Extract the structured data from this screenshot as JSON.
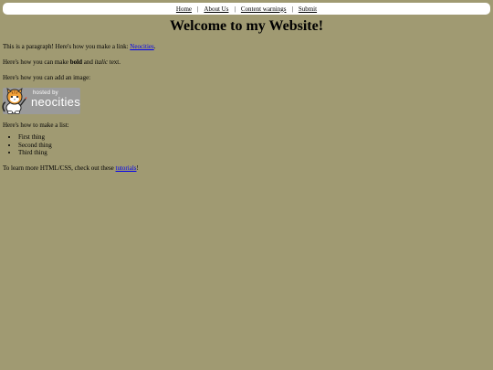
{
  "nav": {
    "items": [
      "Home",
      "About Us",
      "Content warnings",
      "Submit"
    ]
  },
  "page_title": "Welcome to my Website!",
  "para1": {
    "text": "This is a paragraph! Here's how you make a link: ",
    "link": "Neocities",
    "after": "."
  },
  "para2": {
    "before": "Here's how you can make ",
    "bold": "bold",
    "middle": " and ",
    "italic": "italic",
    "after": " text."
  },
  "para3": {
    "text": "Here's how you can add an image:"
  },
  "badge": {
    "hosted": "hosted by",
    "brand": "neocities",
    "icon": "neocities-cat-icon"
  },
  "para4": {
    "text": "Here's how to make a list:"
  },
  "list": [
    "First thing",
    "Second thing",
    "Third thing"
  ],
  "para5": {
    "text": "To learn more HTML/CSS, check out these ",
    "link": "tutorials",
    "after": "!"
  },
  "colors": {
    "background": "#a09a72",
    "nav_background": "#ffffff",
    "link": "#0000ee"
  }
}
